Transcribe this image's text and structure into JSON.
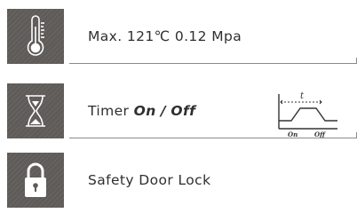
{
  "features": [
    {
      "icon": "thermometer-icon",
      "label": "Max. 121℃  0.12 Mpa"
    },
    {
      "icon": "hourglass-icon",
      "label_prefix": "Timer",
      "label_on": "On",
      "label_separator": "/",
      "label_off": "Off",
      "diagram": {
        "t_label": "t",
        "on_label": "On",
        "off_label": "Off"
      }
    },
    {
      "icon": "padlock-icon",
      "label": "Safety Door Lock"
    }
  ],
  "colors": {
    "tile": "#5e5b58",
    "icon_stroke": "#ffffff",
    "text": "#2f2f2f",
    "rule": "#8a8a8a"
  }
}
